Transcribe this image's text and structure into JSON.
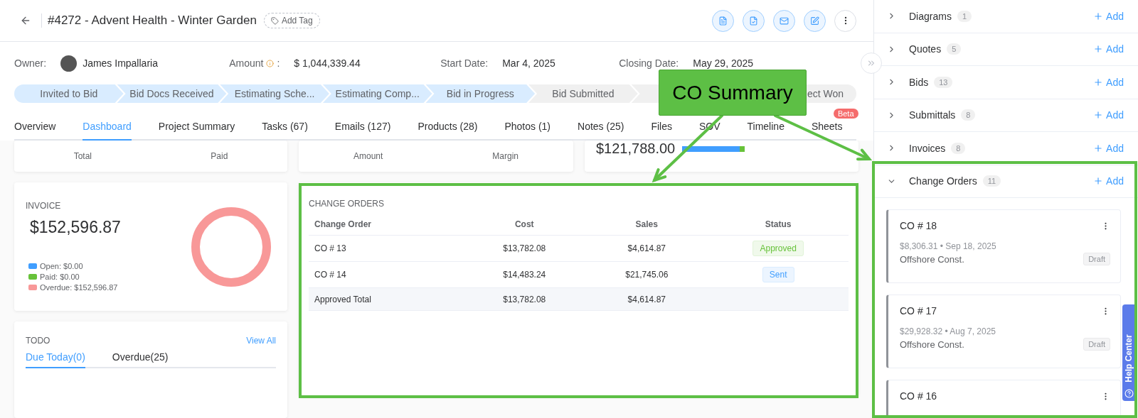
{
  "header": {
    "title": "#4272 - Advent Health - Winter Garden",
    "tag_button": "Add Tag"
  },
  "info": {
    "owner_label": "Owner:",
    "owner": "James Impallaria",
    "amount_label": "Amount",
    "amount_colon": ":",
    "amount": "$ 1,044,339.44",
    "start_label": "Start Date:",
    "start": "Mar 4, 2025",
    "closing_label": "Closing Date:",
    "closing": "May 29, 2025"
  },
  "stages": [
    {
      "label": "Invited to Bid",
      "done": true
    },
    {
      "label": "Bid Docs Received",
      "done": true
    },
    {
      "label": "Estimating Sche...",
      "done": true
    },
    {
      "label": "Estimating Comp...",
      "done": true
    },
    {
      "label": "Bid in Progress",
      "done": true
    },
    {
      "label": "Bid Submitted",
      "done": false
    },
    {
      "done": false
    },
    {
      "label": "ect Won",
      "done": false
    }
  ],
  "tabs": [
    {
      "label": "Overview",
      "selected": false
    },
    {
      "label": "Dashboard",
      "selected": true
    },
    {
      "label": "Project Summary",
      "selected": false
    },
    {
      "label": "Tasks (67)",
      "selected": false
    },
    {
      "label": "Emails (127)",
      "selected": false
    },
    {
      "label": "Products (28)",
      "selected": false
    },
    {
      "label": "Photos (1)",
      "selected": false
    },
    {
      "label": "Notes (25)",
      "selected": false
    },
    {
      "label": "Files",
      "selected": false
    },
    {
      "label": "SOV",
      "selected": false
    },
    {
      "label": "Timeline",
      "selected": false
    },
    {
      "label": "Sheets",
      "selected": false,
      "badge": "Beta"
    }
  ],
  "summary_cards": [
    {
      "labels": [
        "Total",
        "Paid"
      ]
    },
    {
      "labels": [
        "Amount",
        "Margin"
      ]
    },
    {
      "value": "$121,788.00",
      "level": 0.92
    }
  ],
  "invoice": {
    "title": "INVOICE",
    "total": "$152,596.87",
    "legend": [
      {
        "label": "Open: $0.00",
        "color": "#409eff"
      },
      {
        "label": "Paid: $0.00",
        "color": "#67c23a"
      },
      {
        "label": "Overdue: $152,596.87",
        "color": "#f89898"
      }
    ]
  },
  "todo": {
    "title": "TODO",
    "view_all": "View All",
    "tabs": [
      {
        "label": "Due Today(0)",
        "selected": true
      },
      {
        "label": "Overdue(25)",
        "selected": false
      }
    ]
  },
  "change_orders": {
    "title": "CHANGE ORDERS",
    "columns": [
      "Change Order",
      "Cost",
      "Sales",
      "Status"
    ],
    "rows": [
      {
        "cells": [
          "CO # 13",
          "$13,782.08",
          "$4,614.87"
        ],
        "status": {
          "label": "Approved",
          "kind": "approved"
        }
      },
      {
        "cells": [
          "CO # 14",
          "$14,483.24",
          "$21,745.06"
        ],
        "status": {
          "label": "Sent",
          "kind": "sent"
        }
      }
    ],
    "total": [
      "Approved Total",
      "$13,782.08",
      "$4,614.87"
    ]
  },
  "side_sections": [
    {
      "label": "Diagrams",
      "count": "1",
      "add": "Add",
      "expanded": false
    },
    {
      "label": "Quotes",
      "count": "5",
      "add": "Add",
      "expanded": false
    },
    {
      "label": "Bids",
      "count": "13",
      "add": "Add",
      "expanded": false
    },
    {
      "label": "Submittals",
      "count": "8",
      "add": "Add",
      "expanded": false
    },
    {
      "label": "Invoices",
      "count": "8",
      "add": "Add",
      "expanded": false
    },
    {
      "label": "Change Orders",
      "count": "11",
      "add": "Add",
      "expanded": true
    }
  ],
  "co_cards": [
    {
      "title": "CO # 18",
      "meta": "$8,306.31 • Sep 18, 2025",
      "company": "Offshore Const.",
      "status": "Draft"
    },
    {
      "title": "CO # 17",
      "meta": "$29,928.32 • Aug 7, 2025",
      "company": "Offshore Const.",
      "status": "Draft"
    },
    {
      "title": "CO # 16"
    }
  ],
  "help_center": "Help Center",
  "annotation": {
    "label": "CO Summary"
  }
}
